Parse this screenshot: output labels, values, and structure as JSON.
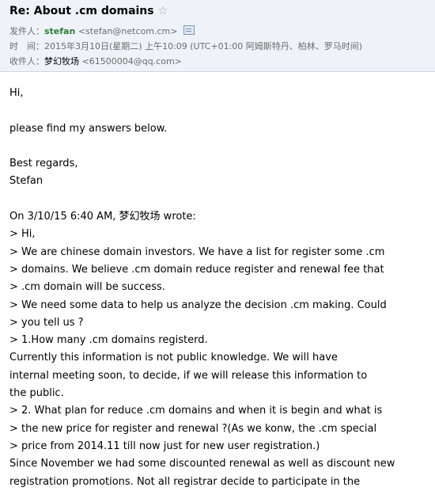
{
  "header": {
    "subject": "Re: About .cm domains",
    "from_label": "发件人：",
    "from_name": "stefan",
    "from_email": "<stefan@netcom.cm>",
    "time_label": "时　间：",
    "time_value": "2015年3月10日(星期二) 上午10:09 (UTC+01:00 阿姆斯特丹、柏林、罗马时间)",
    "to_label": "收件人：",
    "to_name": "梦幻牧场",
    "to_email": "<61500004@qq.com>"
  },
  "body": {
    "lines": [
      "Hi,",
      "",
      "please find my answers below.",
      "",
      "Best regards,",
      "Stefan",
      "",
      "On 3/10/15 6:40 AM, 梦幻牧场 wrote:",
      "> Hi,",
      "> We are chinese domain investors. We have a list for register some .cm",
      "> domains. We believe .cm domain reduce register and renewal fee that",
      "> .cm domain will be success.",
      "> We need some data to help us analyze the decision .cm making. Could",
      "> you tell us ?",
      "> 1.How many .cm domains registerd.",
      "Currently this information is not public knowledge. We will have",
      "internal meeting soon, to decide, if we will release this information to",
      "the public.",
      "> 2. What plan for reduce .cm domains and when it is begin and what is",
      "> the new price for register and renewal ?(As we konw, the .cm special",
      "> price from 2014.11 till now just for new user registration.)",
      "Since November we had some discounted renewal as well as discount new",
      "registration promotions. Not all registrar decide to participate in the"
    ]
  }
}
